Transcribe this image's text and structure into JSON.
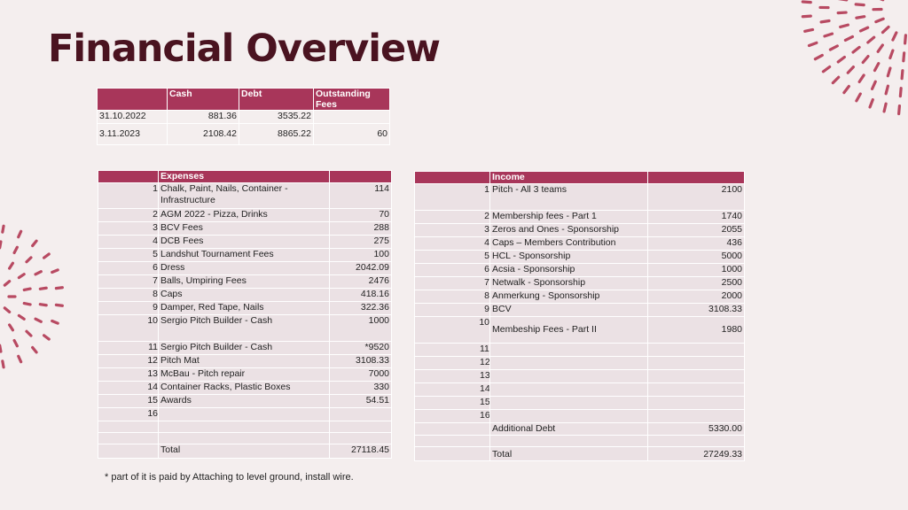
{
  "title": "Financial Overview",
  "colors": {
    "accent": "#a8365a",
    "title": "#4a1320",
    "cell": "#ebe1e4",
    "background": "#f4eeee"
  },
  "summary": {
    "headers": [
      "",
      "Cash",
      "Debt",
      "Outstanding Fees"
    ],
    "rows": [
      [
        "31.10.2022",
        "881.36",
        "3535.22",
        ""
      ],
      [
        "3.11.2023",
        "2108.42",
        "8865.22",
        "60"
      ]
    ]
  },
  "expenses": {
    "header": "Expenses",
    "rows": [
      {
        "n": "1",
        "label": "Chalk, Paint, Nails, Container - Infrastructure",
        "value": "114"
      },
      {
        "n": "2",
        "label": "AGM 2022 - Pizza, Drinks",
        "value": "70"
      },
      {
        "n": "3",
        "label": "BCV Fees",
        "value": "288"
      },
      {
        "n": "4",
        "label": "DCB Fees",
        "value": "275"
      },
      {
        "n": "5",
        "label": "Landshut Tournament Fees",
        "value": "100"
      },
      {
        "n": "6",
        "label": "Dress",
        "value": "2042.09"
      },
      {
        "n": "7",
        "label": "Balls, Umpiring Fees",
        "value": "2476"
      },
      {
        "n": "8",
        "label": "Caps",
        "value": "418.16"
      },
      {
        "n": "9",
        "label": "Damper, Red Tape, Nails",
        "value": "322.36"
      },
      {
        "n": "10",
        "label": "Sergio Pitch Builder - Cash",
        "value": "1000"
      },
      {
        "n": "11",
        "label": "Sergio Pitch Builder - Cash",
        "value": "*9520"
      },
      {
        "n": "12",
        "label": "Pitch Mat",
        "value": "3108.33"
      },
      {
        "n": "13",
        "label": "McBau - Pitch repair",
        "value": "7000"
      },
      {
        "n": "14",
        "label": "Container Racks, Plastic Boxes",
        "value": "330"
      },
      {
        "n": "15",
        "label": "Awards",
        "value": "54.51"
      },
      {
        "n": "16",
        "label": "",
        "value": ""
      }
    ],
    "total_label": "Total",
    "total_value": "27118.45"
  },
  "income": {
    "header": "Income",
    "rows": [
      {
        "n": "1",
        "label": "Pitch - All 3 teams",
        "value": "2100"
      },
      {
        "n": "2",
        "label": "Membership fees - Part 1",
        "value": "1740"
      },
      {
        "n": "3",
        "label": "Zeros and Ones - Sponsorship",
        "value": "2055"
      },
      {
        "n": "4",
        "label": "Caps – Members Contribution",
        "value": "436"
      },
      {
        "n": "5",
        "label": "HCL - Sponsorship",
        "value": "5000"
      },
      {
        "n": "6",
        "label": "Acsia - Sponsorship",
        "value": "1000"
      },
      {
        "n": "7",
        "label": "Netwalk -  Sponsorship",
        "value": "2500"
      },
      {
        "n": "8",
        "label": "Anmerkung - Sponsorship",
        "value": "2000"
      },
      {
        "n": "9",
        "label": "BCV",
        "value": "3108.33"
      },
      {
        "n": "10",
        "label": "Membeship Fees - Part II",
        "value": "1980"
      },
      {
        "n": "11",
        "label": "",
        "value": ""
      },
      {
        "n": "12",
        "label": "",
        "value": ""
      },
      {
        "n": "13",
        "label": "",
        "value": ""
      },
      {
        "n": "14",
        "label": "",
        "value": ""
      },
      {
        "n": "15",
        "label": "",
        "value": ""
      },
      {
        "n": "16",
        "label": "",
        "value": ""
      }
    ],
    "additional_label": "Additional Debt",
    "additional_value": "5330.00",
    "total_label": "Total",
    "total_value": "27249.33"
  },
  "footnote": "* part of it is paid by Attaching to level ground, install wire."
}
